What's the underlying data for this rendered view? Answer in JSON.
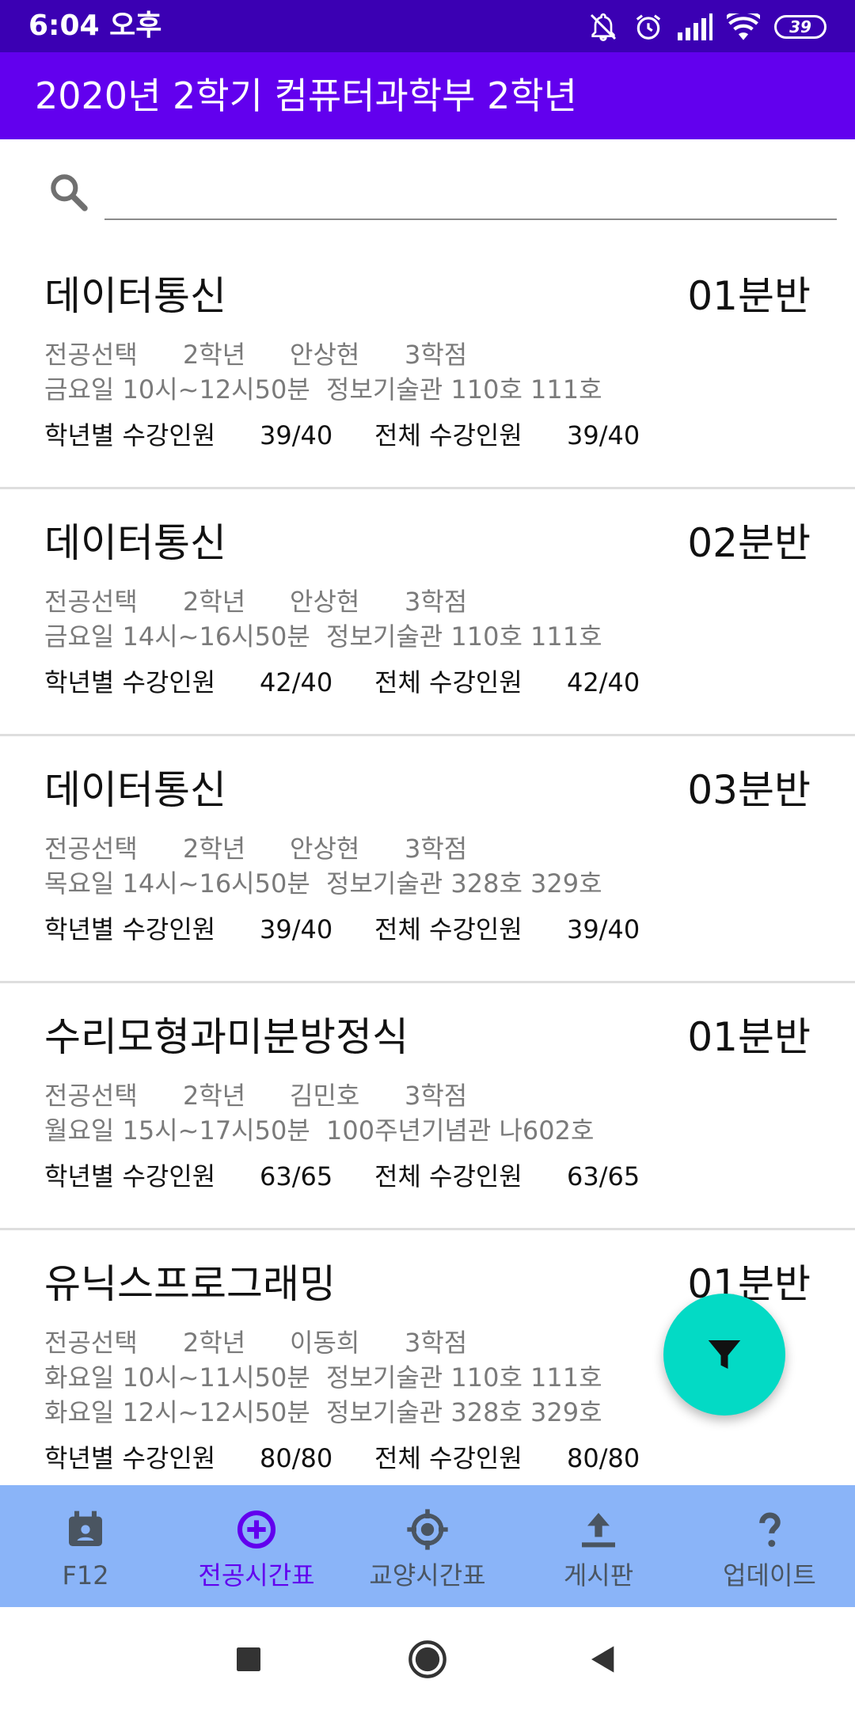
{
  "status_bar": {
    "time": "6:04 오후",
    "battery": "39",
    "icons": [
      "mute-icon",
      "alarm-icon",
      "signal-icon",
      "wifi-icon",
      "battery-icon"
    ]
  },
  "app_bar": {
    "title": "2020년 2학기 컴퓨터과학부 2학년"
  },
  "search": {
    "placeholder": "",
    "value": "",
    "icon": "search-icon"
  },
  "labels": {
    "grade_enrollment": "학년별 수강인원",
    "total_enrollment": "전체 수강인원"
  },
  "courses": [
    {
      "name": "데이터통신",
      "section": "01분반",
      "type": "전공선택",
      "year": "2학년",
      "professor": "안상현",
      "credits": "3학점",
      "schedule": [
        {
          "time": "금요일 10시~12시50분",
          "room": "정보기술관 110호 111호"
        }
      ],
      "grade_enrollment": "39/40",
      "total_enrollment": "39/40"
    },
    {
      "name": "데이터통신",
      "section": "02분반",
      "type": "전공선택",
      "year": "2학년",
      "professor": "안상현",
      "credits": "3학점",
      "schedule": [
        {
          "time": "금요일 14시~16시50분",
          "room": "정보기술관 110호 111호"
        }
      ],
      "grade_enrollment": "42/40",
      "total_enrollment": "42/40"
    },
    {
      "name": "데이터통신",
      "section": "03분반",
      "type": "전공선택",
      "year": "2학년",
      "professor": "안상현",
      "credits": "3학점",
      "schedule": [
        {
          "time": "목요일 14시~16시50분",
          "room": "정보기술관 328호 329호"
        }
      ],
      "grade_enrollment": "39/40",
      "total_enrollment": "39/40"
    },
    {
      "name": "수리모형과미분방정식",
      "section": "01분반",
      "type": "전공선택",
      "year": "2학년",
      "professor": "김민호",
      "credits": "3학점",
      "schedule": [
        {
          "time": "월요일 15시~17시50분",
          "room": "100주년기념관 나602호"
        }
      ],
      "grade_enrollment": "63/65",
      "total_enrollment": "63/65"
    },
    {
      "name": "유닉스프로그래밍",
      "section": "01분반",
      "type": "전공선택",
      "year": "2학년",
      "professor": "이동희",
      "credits": "3학점",
      "schedule": [
        {
          "time": "화요일 10시~11시50분",
          "room": "정보기술관 110호 111호"
        },
        {
          "time": "화요일 12시~12시50분",
          "room": "정보기술관 328호 329호"
        }
      ],
      "grade_enrollment": "80/80",
      "total_enrollment": "80/80"
    }
  ],
  "fab": {
    "icon": "filter-icon"
  },
  "bottom_nav": {
    "active_index": 1,
    "items": [
      {
        "label": "F12",
        "icon": "calendar-icon"
      },
      {
        "label": "전공시간표",
        "icon": "add-circle-icon"
      },
      {
        "label": "교양시간표",
        "icon": "target-icon"
      },
      {
        "label": "게시판",
        "icon": "upload-icon"
      },
      {
        "label": "업데이트",
        "icon": "help-icon"
      }
    ]
  },
  "system_nav": {
    "icons": [
      "recents-icon",
      "home-icon",
      "back-icon"
    ]
  },
  "colors": {
    "status_bar": "#3b00b3",
    "app_bar": "#6200ee",
    "fab": "#03dac5",
    "bottom_nav": "#8ab4f8",
    "active_nav": "#6200ee"
  }
}
